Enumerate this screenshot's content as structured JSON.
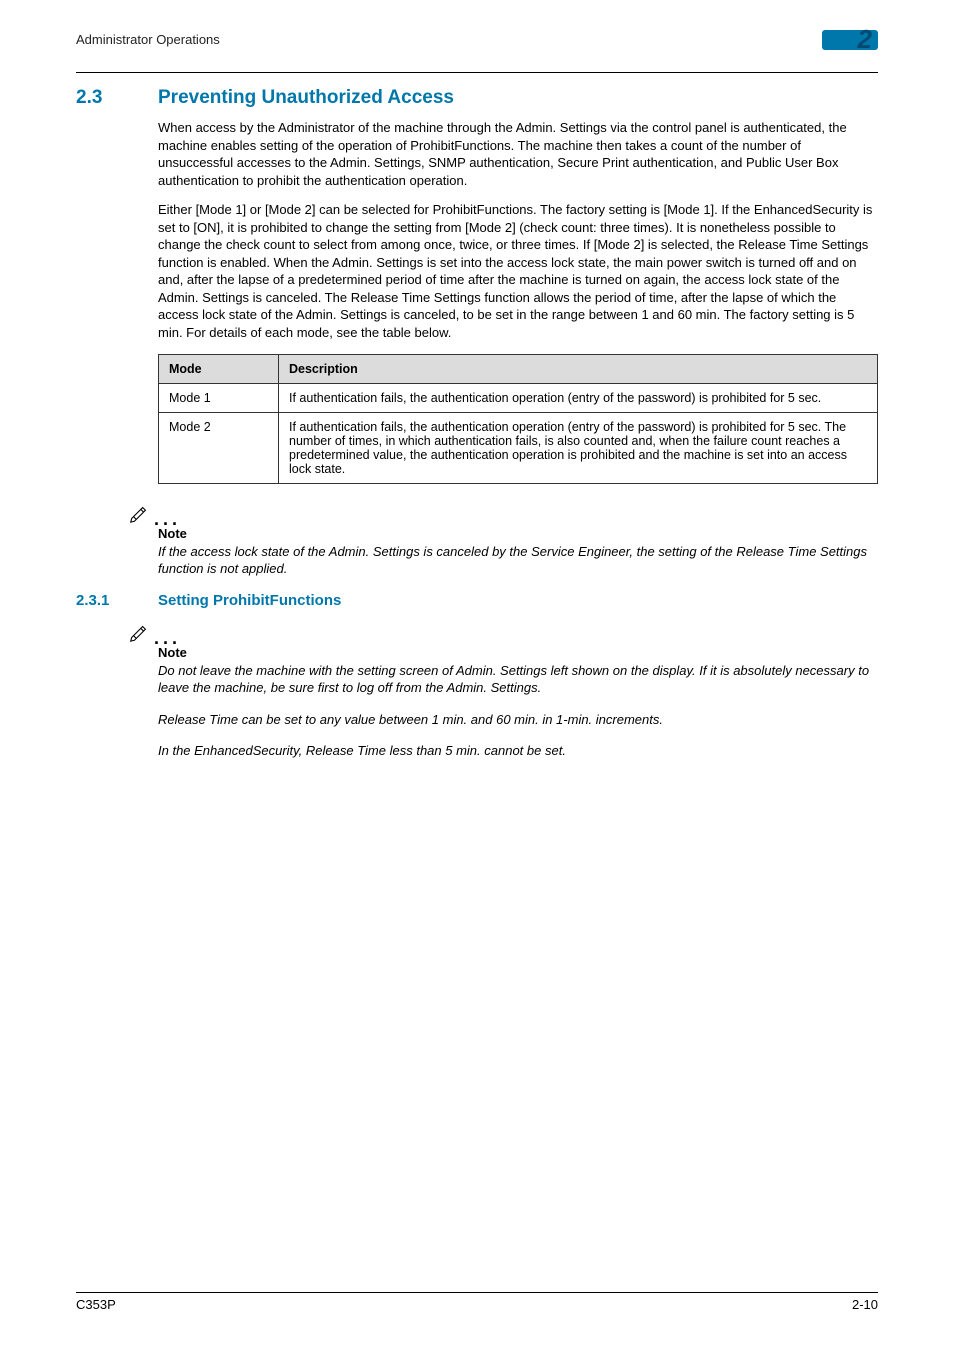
{
  "header": {
    "running_title": "Administrator Operations",
    "chapter_number": "2"
  },
  "section": {
    "number": "2.3",
    "title": "Preventing Unauthorized Access",
    "para1": "When access by the Administrator of the machine through the Admin. Settings via the control panel is authenticated, the machine enables setting of the operation of ProhibitFunctions. The machine then takes a count of the number of unsuccessful accesses to the Admin. Settings, SNMP authentication, Secure Print authentication, and Public User Box authentication to prohibit the authentication operation.",
    "para2": "Either [Mode 1] or [Mode 2] can be selected for ProhibitFunctions. The factory setting is [Mode 1]. If the EnhancedSecurity is set to [ON], it is prohibited to change the setting from [Mode 2] (check count: three times). It is nonetheless possible to change the check count to select from among once, twice, or three times. If [Mode 2] is selected, the Release Time Settings function is enabled. When the Admin. Settings is set into the access lock state, the main power switch is turned off and on and, after the lapse of a predetermined period of time after the machine is turned on again, the access lock state of the Admin. Settings is canceled. The Release Time Settings function allows the period of time, after the lapse of which the access lock state of the Admin. Settings is canceled, to be set in the range between 1 and 60 min. The factory setting is 5 min. For details of each mode, see the table below."
  },
  "table": {
    "head_mode": "Mode",
    "head_desc": "Description",
    "rows": [
      {
        "mode": "Mode 1",
        "desc": "If authentication fails, the authentication operation (entry of the password) is prohibited for 5 sec."
      },
      {
        "mode": "Mode 2",
        "desc": "If authentication fails, the authentication operation (entry of the password) is prohibited for 5 sec. The number of times, in which authentication fails, is also counted and, when the failure count reaches a predetermined value, the authentication operation is prohibited and the machine is set into an access lock state."
      }
    ]
  },
  "note1": {
    "label": "Note",
    "body": "If the access lock state of the Admin. Settings is canceled by the Service Engineer, the setting of the Release Time Settings function is not applied."
  },
  "subsection": {
    "number": "2.3.1",
    "title": "Setting ProhibitFunctions"
  },
  "note2": {
    "label": "Note",
    "body1": "Do not leave the machine with the setting screen of Admin. Settings left shown on the display. If it is absolutely necessary to leave the machine, be sure first to log off from the Admin. Settings.",
    "body2": "Release Time can be set to any value between 1 min. and 60 min. in 1-min. increments.",
    "body3": "In the EnhancedSecurity, Release Time less than 5 min. cannot be set."
  },
  "footer": {
    "model": "C353P",
    "page": "2-10"
  }
}
